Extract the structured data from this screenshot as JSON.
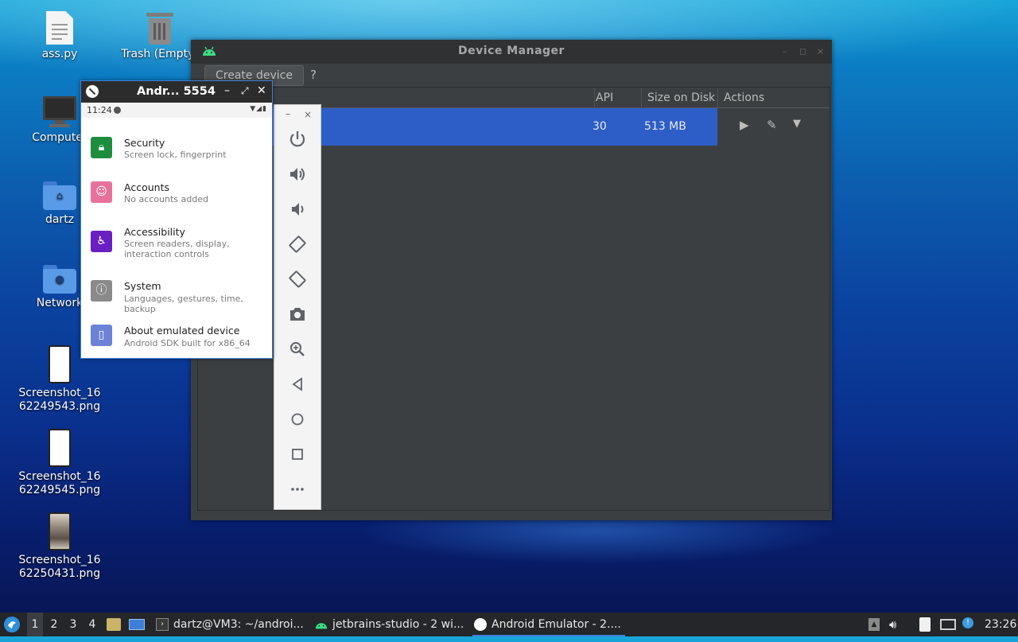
{
  "desktop": {
    "icons": [
      {
        "label": "ass.py"
      },
      {
        "label": "Trash (Empty)"
      },
      {
        "label": "Computer"
      },
      {
        "label": "dartz"
      },
      {
        "label": "Network"
      },
      {
        "label": "Screenshot_1662249543.png"
      },
      {
        "label": "Screenshot_1662249545.png"
      },
      {
        "label": "Screenshot_1662250431.png"
      }
    ]
  },
  "device_manager": {
    "title": "Device Manager",
    "create_button": "Create device",
    "help": "?",
    "columns": [
      "API",
      "Size on Disk",
      "Actions"
    ],
    "rows": [
      {
        "api": "30",
        "size": "513 MB"
      }
    ]
  },
  "emulator": {
    "title": "Andr... 5554",
    "status_time": "11:24",
    "settings": [
      {
        "title": "Security",
        "subtitle": "Screen lock, fingerprint",
        "color": "#1e8e3e",
        "icon": "lock-icon"
      },
      {
        "title": "Accounts",
        "subtitle": "No accounts added",
        "color": "#e8719c",
        "icon": "account-icon"
      },
      {
        "title": "Accessibility",
        "subtitle": "Screen readers, display, interaction controls",
        "color": "#6a1fc2",
        "icon": "accessibility-icon"
      },
      {
        "title": "System",
        "subtitle": "Languages, gestures, time, backup",
        "color": "#8a8a8a",
        "icon": "info-icon"
      },
      {
        "title": "About emulated device",
        "subtitle": "Android SDK built for x86_64",
        "color": "#6b82d6",
        "icon": "phone-icon"
      }
    ],
    "sidebar_controls": [
      "power-icon",
      "volume-up-icon",
      "volume-down-icon",
      "rotate-left-icon",
      "rotate-right-icon",
      "camera-icon",
      "zoom-icon",
      "back-icon",
      "home-icon",
      "overview-icon",
      "more-icon"
    ]
  },
  "taskbar": {
    "workspaces": [
      "1",
      "2",
      "3",
      "4"
    ],
    "tasks": [
      {
        "label": "dartz@VM3: ~/androi..."
      },
      {
        "label": "jetbrains-studio - 2 wi..."
      },
      {
        "label": "Android Emulator - 2...."
      }
    ],
    "clock": "23:26"
  }
}
